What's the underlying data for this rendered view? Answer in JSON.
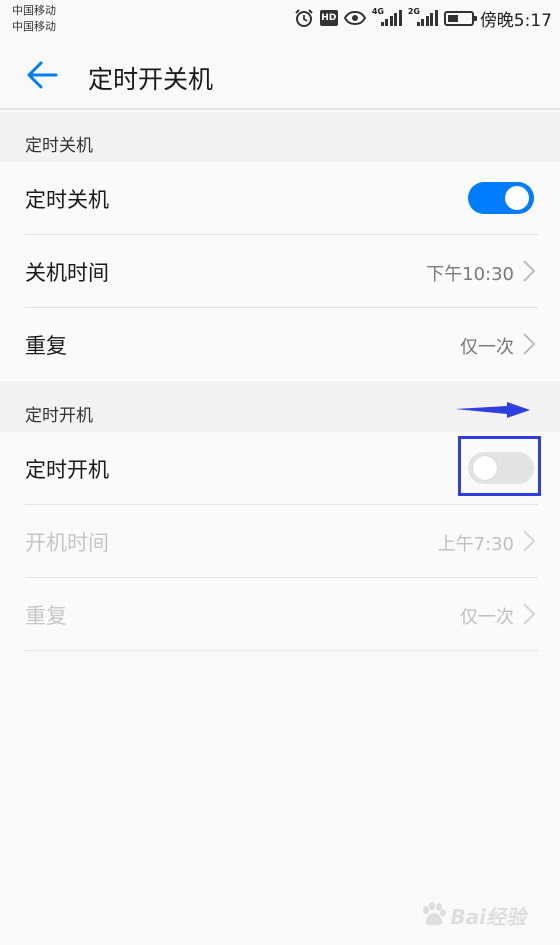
{
  "status_bar": {
    "carrier_1": "中国移动",
    "carrier_2": "中国移动",
    "hd_badge": "HD",
    "net_1": "4G",
    "net_2": "2G",
    "time": "傍晚5:17",
    "battery_level": 0.45
  },
  "header": {
    "title": "定时开关机"
  },
  "shutdown_section": {
    "header": "定时关机",
    "toggle_label": "定时关机",
    "toggle_on": true,
    "time_label": "关机时间",
    "time_value": "下午10:30",
    "repeat_label": "重复",
    "repeat_value": "仅一次"
  },
  "startup_section": {
    "header": "定时开机",
    "toggle_label": "定时开机",
    "toggle_on": false,
    "time_label": "开机时间",
    "time_value": "上午7:30",
    "repeat_label": "重复",
    "repeat_value": "仅一次"
  },
  "annotation": {
    "color": "#2d3fe0"
  },
  "watermark": {
    "text": "Bai经验"
  },
  "colors": {
    "accent": "#007dff",
    "toggle_off": "#e3e3e3",
    "disabled_text": "#c6c6c6"
  }
}
